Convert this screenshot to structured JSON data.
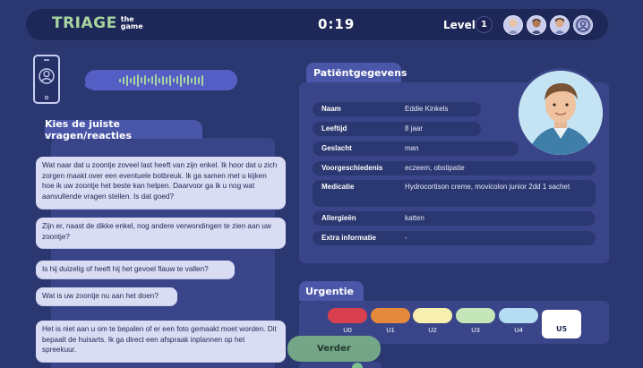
{
  "app": {
    "logo_main": "TRIAGE",
    "logo_sub_1": "the",
    "logo_sub_2": "game"
  },
  "header": {
    "timer": "0:19",
    "level_label": "Level",
    "level_value": "1",
    "avatars": [
      "player-avatar-1",
      "player-avatar-2",
      "player-avatar-3",
      "empty-avatar-slot"
    ]
  },
  "call": {
    "phone_icon": "phone-caller-icon",
    "audio_icon": "audio-waveform-icon"
  },
  "questions": {
    "title": "Kies de juiste vragen/reacties",
    "items": [
      "Wat naar dat u zoontje zoveel last heeft van zijn enkel. Ik hoor dat u zich zorgen maakt over een eventuele botbreuk. Ik ga samen met u kijken hoe ik uw zoontje het beste kan helpen. Daarvoor ga ik u nog wat aanvullende vragen stellen. Is dat goed?",
      "Zijn er, naast de dikke enkel, nog andere verwondingen te zien aan uw zoontje?",
      "Is hij duizelig of heeft hij het gevoel flauw te vallen?",
      "Wat is uw zoontje nu aan het doen?",
      "Het is niet aan u om te bepalen of er een foto gemaakt moet worden. Dit bepaalt de huisarts. Ik ga direct een afspraak inplannen op het spreekuur."
    ]
  },
  "patient": {
    "title": "Patiëntgegevens",
    "rows": [
      {
        "label": "Naam",
        "value": "Eddie Kinkels"
      },
      {
        "label": "Leeftijd",
        "value": "8 jaar"
      },
      {
        "label": "Geslacht",
        "value": "man"
      },
      {
        "label": "Voorgeschiedenis",
        "value": "eczeem, obstipatie"
      },
      {
        "label": "Medicatie",
        "value": "Hydrocortison creme, movicolon junior 2dd 1 sachet"
      },
      {
        "label": "Allergieën",
        "value": "katten"
      },
      {
        "label": "Extra informatie",
        "value": "-"
      }
    ]
  },
  "urgency": {
    "title": "Urgentie",
    "levels": [
      {
        "label": "U0",
        "color": "#d9404f"
      },
      {
        "label": "U1",
        "color": "#e58a3c"
      },
      {
        "label": "U2",
        "color": "#f7efb0"
      },
      {
        "label": "U3",
        "color": "#c5e6b8"
      },
      {
        "label": "U4",
        "color": "#b4dcf3"
      },
      {
        "label": "U5",
        "color": "#ffffff"
      }
    ],
    "selected": "U5"
  },
  "actions": {
    "next_label": "Verder"
  },
  "colors": {
    "background": "#2b3770",
    "panel": "#3a4589",
    "accent": "#a7d5a0",
    "button": "#7aaf88"
  }
}
